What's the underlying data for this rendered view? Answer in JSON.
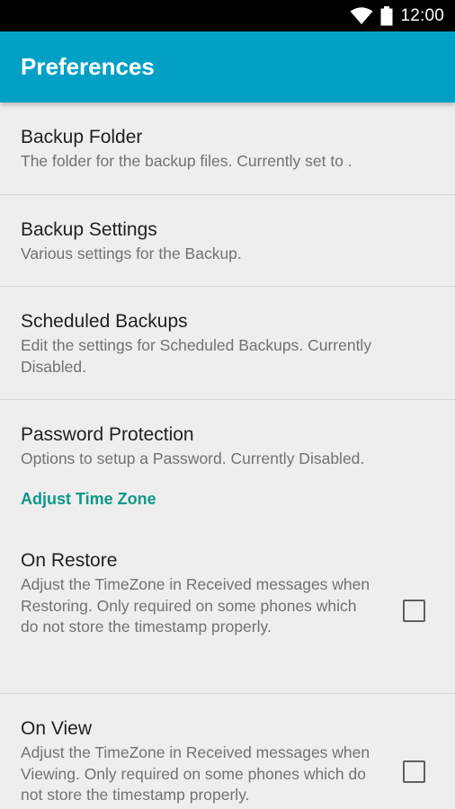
{
  "status_bar": {
    "time": "12:00",
    "icons": [
      "wifi-icon",
      "battery-icon"
    ]
  },
  "app_bar": {
    "title": "Preferences",
    "color": "#03a0c6"
  },
  "preferences": {
    "backup_folder": {
      "title": "Backup Folder",
      "summary": "The folder for the backup files. Currently set to ."
    },
    "backup_settings": {
      "title": "Backup Settings",
      "summary": "Various settings for the Backup."
    },
    "scheduled_backups": {
      "title": "Scheduled Backups",
      "summary": "Edit the settings for Scheduled Backups. Currently Disabled."
    },
    "password_protection": {
      "title": "Password Protection",
      "summary": "Options to setup a Password. Currently Disabled."
    }
  },
  "adjust_time_zone": {
    "category_title": "Adjust Time Zone",
    "accent_color": "#10968a",
    "on_restore": {
      "title": "On Restore",
      "summary": "Adjust the TimeZone in Received messages when Restoring. Only required on some phones which do not store the timestamp properly.",
      "checked": false
    },
    "on_view": {
      "title": "On View",
      "summary": "Adjust the TimeZone in Received messages when Viewing. Only required on some phones which do not store the timestamp properly.",
      "checked": false
    }
  }
}
